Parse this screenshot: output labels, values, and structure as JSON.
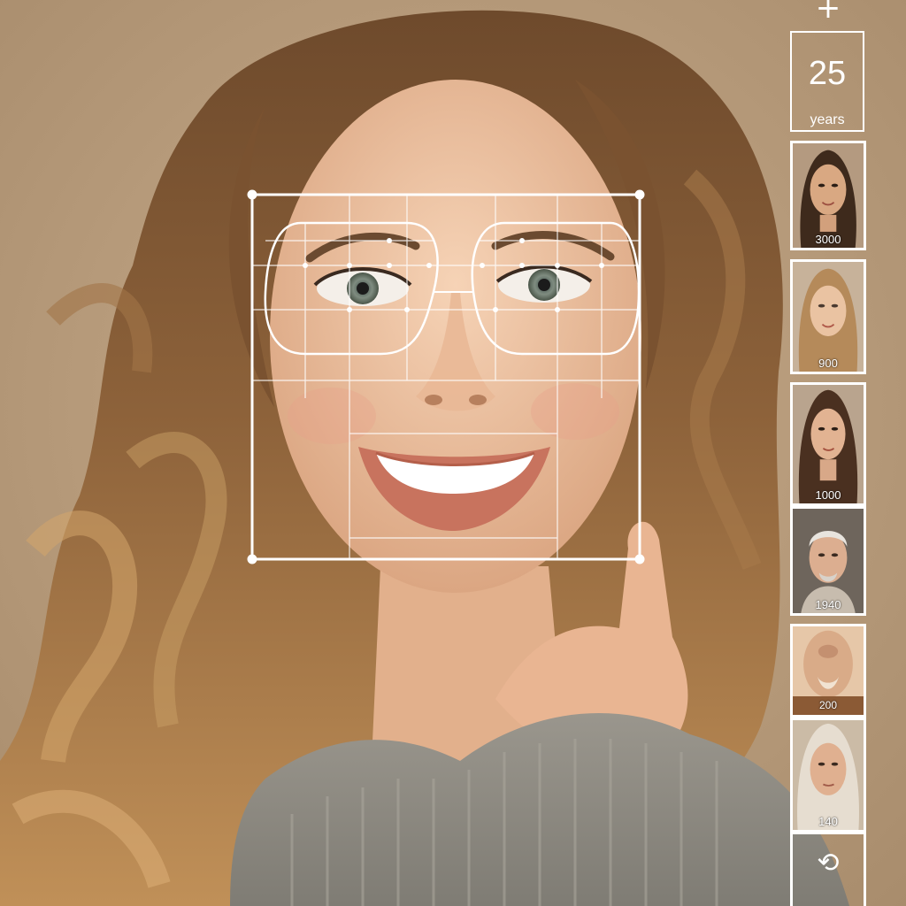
{
  "controls": {
    "add_icon": "plus-icon",
    "age_value": "25",
    "age_unit": "years",
    "reset_icon": "reset-icon"
  },
  "thumbnails": [
    {
      "label": "3000",
      "subject": "young woman dark hair"
    },
    {
      "label": "900",
      "subject": "young woman blonde hair"
    },
    {
      "label": "1000",
      "subject": "woman dark hair"
    },
    {
      "label": "1940",
      "subject": "elderly man"
    },
    {
      "label": "200",
      "subject": "face close-up"
    },
    {
      "label": "140",
      "subject": "older woman grey hair"
    }
  ],
  "colors": {
    "background": "#b89c7c",
    "overlay": "#ffffff",
    "hair": "#8a5f38",
    "skin": "#eec2a0",
    "sweater": "#8e8c84"
  }
}
